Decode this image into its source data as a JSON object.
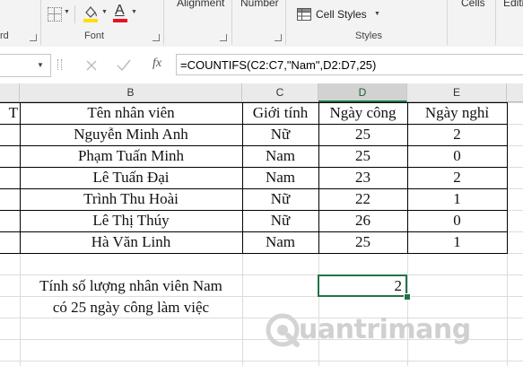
{
  "ribbon": {
    "top_labels": {
      "alignment": "Alignment",
      "number": "Number",
      "cells": "Cells",
      "editing": "Editi"
    },
    "clipboard_label": "rd",
    "font_label": "Font",
    "styles_label": "Styles",
    "cell_styles_label": "Cell Styles",
    "font_color_letter": "A",
    "font_color_accent": "#e81123",
    "fill_color_accent": "#ffde00"
  },
  "formula_bar": {
    "fx_label": "fx",
    "formula": "=COUNTIFS(C2:C7,\"Nam\",D2:D7,25)"
  },
  "sheet": {
    "column_headers": [
      "B",
      "C",
      "D",
      "E"
    ],
    "partial_header": "TT",
    "table": {
      "headers": [
        "Tên nhân viên",
        "Giới tính",
        "Ngày công",
        "Ngày nghỉ"
      ],
      "rows": [
        [
          "Nguyễn Minh Anh",
          "Nữ",
          "25",
          "2"
        ],
        [
          "Phạm Tuấn Minh",
          "Nam",
          "25",
          "0"
        ],
        [
          "Lê Tuấn Đại",
          "Nam",
          "23",
          "2"
        ],
        [
          "Trình Thu Hoài",
          "Nữ",
          "22",
          "1"
        ],
        [
          "Lê Thị Thúy",
          "Nữ",
          "26",
          "0"
        ],
        [
          "Hà Văn Linh",
          "Nam",
          "25",
          "1"
        ]
      ]
    },
    "question_line1": "Tính số lượng nhân viên Nam",
    "question_line2": "có 25 ngày công làm việc",
    "result_value": "2",
    "selection_color": "#217346"
  },
  "watermark": {
    "text": "uantrimang",
    "color": "#d0d0d0"
  }
}
